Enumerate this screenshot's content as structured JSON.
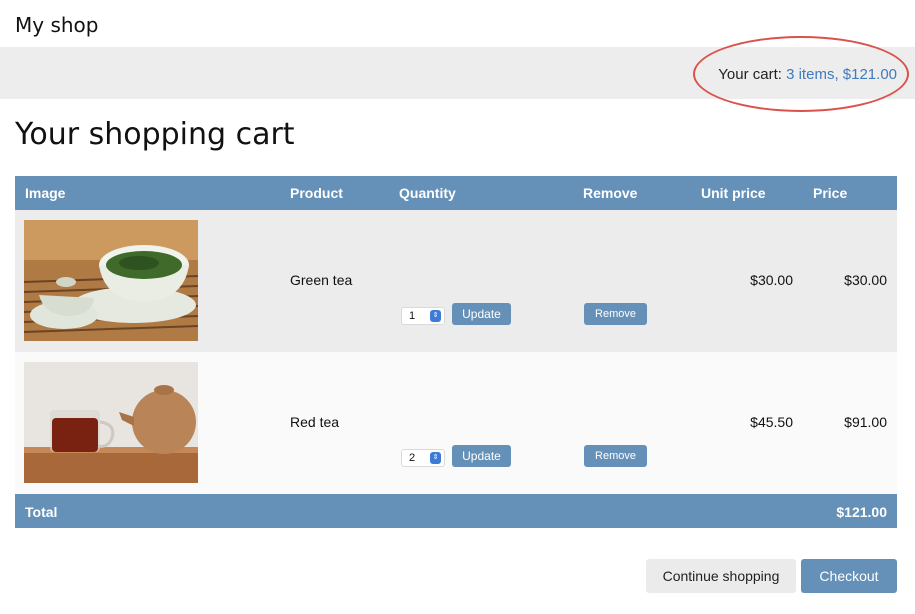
{
  "header": {
    "shop_title": "My shop"
  },
  "cart_summary": {
    "label": "Your cart:",
    "link_text": "3 items, $121.00"
  },
  "page_title": "Your shopping cart",
  "table": {
    "columns": [
      "Image",
      "Product",
      "Quantity",
      "Remove",
      "Unit price",
      "Price"
    ],
    "rows": [
      {
        "product": "Green tea",
        "quantity": "1",
        "update_label": "Update",
        "remove_label": "Remove",
        "unit_price": "$30.00",
        "price": "$30.00"
      },
      {
        "product": "Red tea",
        "quantity": "2",
        "update_label": "Update",
        "remove_label": "Remove",
        "unit_price": "$45.50",
        "price": "$91.00"
      }
    ],
    "total_label": "Total",
    "total_value": "$121.00"
  },
  "actions": {
    "continue_label": "Continue shopping",
    "checkout_label": "Checkout"
  },
  "colors": {
    "accent": "#6590b8",
    "link": "#3f7bbd",
    "highlight": "#d9534a"
  }
}
